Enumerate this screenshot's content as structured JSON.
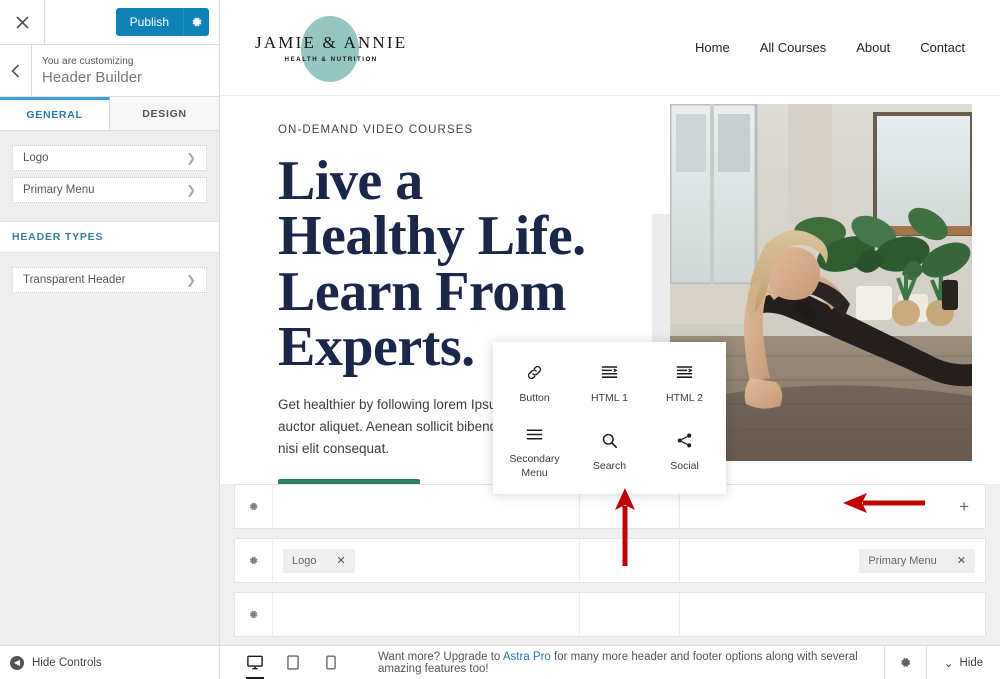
{
  "customizer": {
    "close_label": "✕",
    "publish_label": "Publish",
    "publish_gear_icon": "gear-icon",
    "back_icon": "chevron-left-icon",
    "eyebrow": "You are customizing",
    "panel_title": "Header Builder",
    "tabs": [
      {
        "label": "GENERAL",
        "active": true
      },
      {
        "label": "DESIGN",
        "active": false
      }
    ],
    "items": [
      {
        "label": "Logo",
        "chevron": "❯"
      },
      {
        "label": "Primary Menu",
        "chevron": "❯"
      }
    ],
    "section_heading": "HEADER TYPES",
    "section_items": [
      {
        "label": "Transparent Header",
        "chevron": "❯"
      }
    ]
  },
  "site": {
    "logo_main": "JAMIE & ANNIE",
    "logo_sub": "HEALTH & NUTRITION",
    "nav": [
      "Home",
      "All Courses",
      "About",
      "Contact"
    ],
    "hero": {
      "eyebrow": "ON-DEMAND VIDEO COURSES",
      "heading_lines": [
        "Live a",
        "Healthy Life.",
        "Learn From",
        "Experts."
      ],
      "paragraph": "Get healthier by following lorem Ipsum vel velit auctor aliquet. Aenean sollicit bibendum auctor, nisi elit consequat.",
      "cta_color": "#2b8068",
      "heading_color": "#1b2749"
    }
  },
  "picker": {
    "items": [
      {
        "label": "Button",
        "icon": "link-icon"
      },
      {
        "label": "HTML 1",
        "icon": "html-lines-icon"
      },
      {
        "label": "HTML 2",
        "icon": "html-lines-icon"
      },
      {
        "label": "Secondary Menu",
        "icon": "hamburger-icon"
      },
      {
        "label": "Search",
        "icon": "search-icon"
      },
      {
        "label": "Social",
        "icon": "share-icon"
      }
    ]
  },
  "builder": {
    "rows": [
      {
        "gear_icon": "gear-icon",
        "left": [],
        "center": [],
        "right": [],
        "plus_label": "+",
        "has_plus": true
      },
      {
        "gear_icon": "gear-icon",
        "left": [
          {
            "label": "Logo",
            "remove": "✕"
          }
        ],
        "center": [],
        "right": [
          {
            "label": "Primary Menu",
            "remove": "✕"
          }
        ],
        "has_plus": false
      },
      {
        "gear_icon": "gear-icon",
        "left": [],
        "center": [],
        "right": [],
        "has_plus": false
      }
    ]
  },
  "annotations": {
    "color": "#c00000",
    "arrow_up_target": "element-picker-popup",
    "arrow_left_target": "add-element-plus-button"
  },
  "bottombar": {
    "hide_controls_label": "Hide Controls",
    "devices": [
      {
        "name": "desktop",
        "active": true
      },
      {
        "name": "tablet",
        "active": false
      },
      {
        "name": "mobile",
        "active": false
      }
    ],
    "message_before": "Want more? Upgrade to ",
    "message_link": "Astra Pro",
    "message_after": " for many more header and footer options along with several amazing features too!",
    "gear_icon": "gear-icon",
    "hide_label": "Hide",
    "hide_chevron": "⌄"
  }
}
